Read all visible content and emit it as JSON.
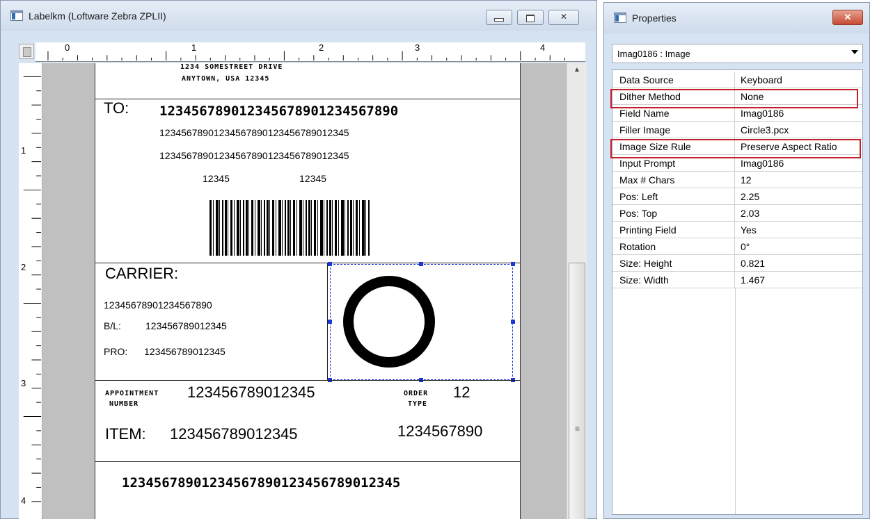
{
  "main_window": {
    "title": "Labelkm (Loftware Zebra ZPLII)",
    "buttons": {
      "minimize": "",
      "maximize": "",
      "close": "✕"
    }
  },
  "ruler": {
    "h_labels": [
      "0",
      "1",
      "2",
      "3",
      "4"
    ],
    "v_labels": [
      "1",
      "2",
      "3",
      "4"
    ]
  },
  "label": {
    "address_line1": "1234 SOMESTREET DRIVE",
    "address_line2": "ANYTOWN, USA  12345",
    "to_label": "TO:",
    "to_value": "123456789012345678901234567890",
    "line1": "12345678901234567890123456789012345",
    "line2": "12345678901234567890123456789012345",
    "zip_left": "12345",
    "zip_right": "12345",
    "carrier_label": "CARRIER:",
    "carrier_value": "12345678901234567890",
    "bl_label": "B/L:",
    "bl_value": "123456789012345",
    "pro_label": "PRO:",
    "pro_value": "123456789012345",
    "appt_label_1": "APPOINTMENT",
    "appt_label_2": "NUMBER",
    "appt_value": "123456789012345",
    "order_label_1": "ORDER",
    "order_label_2": "TYPE",
    "order_value": "12",
    "item_label": "ITEM:",
    "item_value": "123456789012345",
    "item_right": "1234567890",
    "footer_value": "12345678901234567890123456789012345"
  },
  "properties": {
    "title": "Properties",
    "close": "✕",
    "selector": "Imag0186 : Image",
    "rows": [
      {
        "key": "Data Source",
        "value": "Keyboard"
      },
      {
        "key": "Dither Method",
        "value": "None"
      },
      {
        "key": "Field Name",
        "value": "Imag0186"
      },
      {
        "key": "Filler Image",
        "value": "Circle3.pcx"
      },
      {
        "key": "Image Size Rule",
        "value": "Preserve  Aspect Ratio"
      },
      {
        "key": "Input Prompt",
        "value": "Imag0186"
      },
      {
        "key": "Max # Chars",
        "value": "12"
      },
      {
        "key": "Pos: Left",
        "value": "2.25"
      },
      {
        "key": "Pos: Top",
        "value": "2.03"
      },
      {
        "key": "Printing Field",
        "value": "Yes"
      },
      {
        "key": "Rotation",
        "value": "0°"
      },
      {
        "key": "Size: Height",
        "value": "0.821"
      },
      {
        "key": "Size: Width",
        "value": "1.467"
      }
    ],
    "highlight_color": "#c21f2a"
  }
}
